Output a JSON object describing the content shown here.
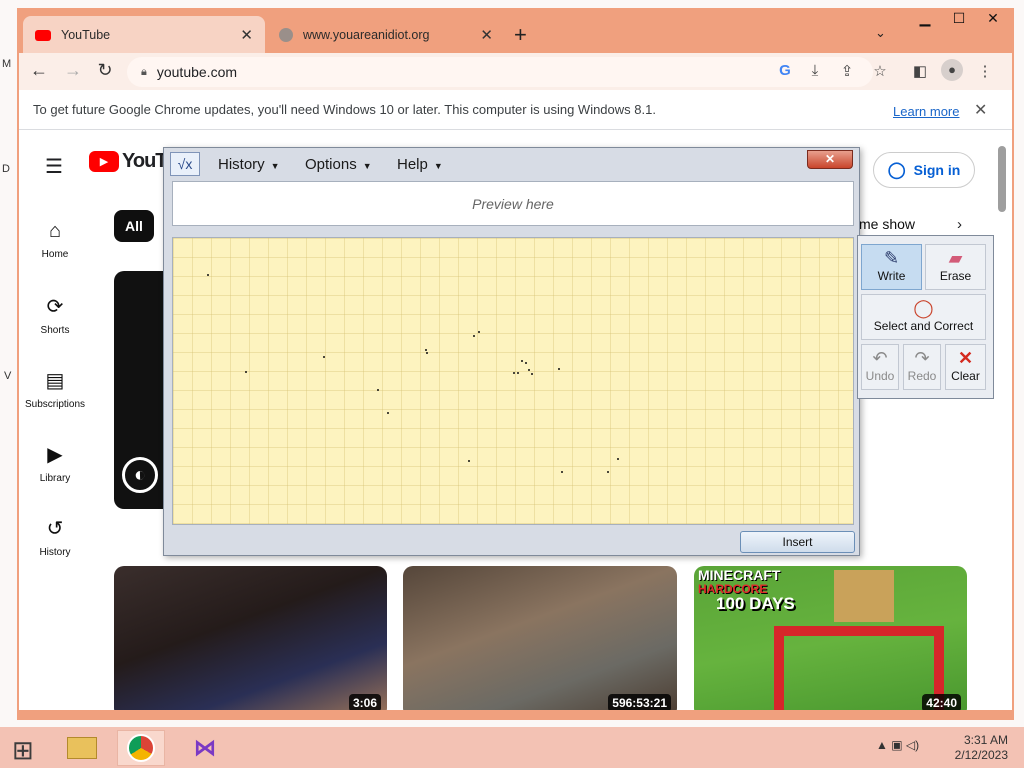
{
  "browser": {
    "tabs": [
      {
        "title": "YouTube",
        "icon": "youtube-favicon",
        "active": true
      },
      {
        "title": "www.youareanidiot.org",
        "icon": "globe-favicon",
        "active": false
      }
    ],
    "new_tab": "+",
    "tab_search": "⌄",
    "window_controls": {
      "minimize": "▁",
      "maximize": "☐",
      "close": "✕"
    },
    "address": "youtube.com",
    "toolbar_icons": [
      "google-icon",
      "install-icon",
      "share-icon",
      "bookmark-star-icon",
      "side-panel-icon",
      "profile-icon",
      "menu-dots-icon"
    ]
  },
  "infobar": {
    "message": "To get future Google Chrome updates, you'll need Windows 10 or later. This computer is using Windows 8.1.",
    "link": "Learn more",
    "close": "✕"
  },
  "youtube": {
    "logo_text": "YouTube",
    "sidebar": [
      {
        "label": "Home",
        "icon": "home-icon",
        "glyph": "⌂"
      },
      {
        "label": "Shorts",
        "icon": "shorts-icon",
        "glyph": "⟳"
      },
      {
        "label": "Subscriptions",
        "icon": "subscriptions-icon",
        "glyph": "▤"
      },
      {
        "label": "Library",
        "icon": "library-icon",
        "glyph": "▶"
      },
      {
        "label": "History",
        "icon": "history-icon",
        "glyph": "↺"
      }
    ],
    "chip_all": "All",
    "chip_partial": "me show",
    "sign_in": "Sign in",
    "videos": [
      {
        "duration": "3:06"
      },
      {
        "duration": "596:53:21"
      },
      {
        "duration": "42:40",
        "title_lines": [
          "MINECRAFT",
          "HARDCORE",
          "100 DAYS"
        ]
      }
    ]
  },
  "math_input_panel": {
    "menus": [
      {
        "label": "History"
      },
      {
        "label": "Options"
      },
      {
        "label": "Help"
      }
    ],
    "preview_placeholder": "Preview here",
    "insert_label": "Insert",
    "tools": {
      "write": "Write",
      "erase": "Erase",
      "select": "Select and Correct",
      "undo": "Undo",
      "redo": "Redo",
      "clear": "Clear"
    }
  },
  "taskbar": {
    "apps": [
      "file-explorer-icon",
      "chrome-icon",
      "visual-studio-icon"
    ],
    "tray": "▲ ▣ ◁)",
    "time": "3:31 AM",
    "date": "2/12/2023"
  },
  "desktop_edge": {
    "labels": [
      "M",
      "D",
      "V"
    ]
  }
}
